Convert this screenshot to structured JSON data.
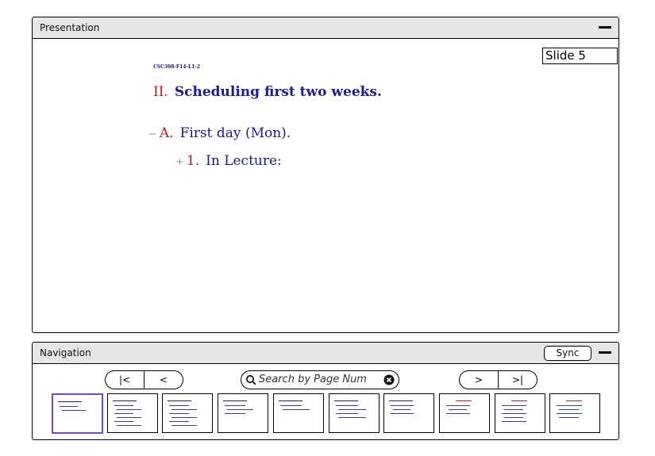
{
  "presentation": {
    "title": "Presentation",
    "slide_indicator": "Slide 5",
    "course_code": "CSC308-F14-L1-2",
    "heading_number": "II.",
    "heading_text": "Scheduling first two weeks.",
    "item_a": {
      "marker": "−",
      "label": "A.",
      "text": "First day (Mon)."
    },
    "item_1": {
      "marker": "+",
      "label": "1.",
      "text": "In Lecture:"
    }
  },
  "navigation": {
    "title": "Navigation",
    "sync_label": "Sync",
    "first_label": "|<",
    "prev_label": "<",
    "next_label": ">",
    "last_label": ">|",
    "search_placeholder": "Search by Page Num",
    "active_thumbnail": 1,
    "thumbnail_count": 10
  },
  "colors": {
    "accent": "#7b3fe4",
    "heading_blue": "#1a1a9a",
    "outline_red": "#c0181b"
  }
}
